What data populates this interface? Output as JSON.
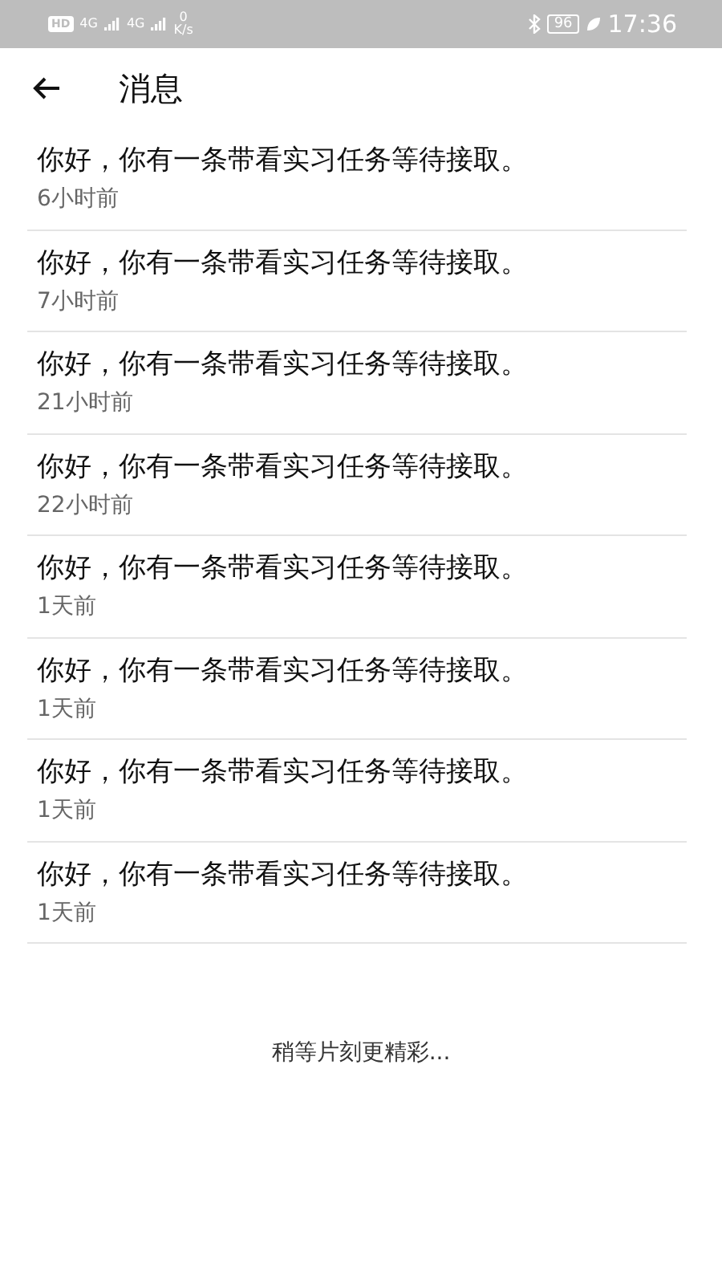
{
  "status_bar": {
    "hd": "HD",
    "networks": [
      "4G",
      "4G"
    ],
    "speed_value": "0",
    "speed_unit": "K/s",
    "battery": "96",
    "time": "17:36"
  },
  "header": {
    "title": "消息"
  },
  "messages": [
    {
      "text": "你好，你有一条带看实习任务等待接取。",
      "time": "6小时前"
    },
    {
      "text": "你好，你有一条带看实习任务等待接取。",
      "time": "7小时前"
    },
    {
      "text": "你好，你有一条带看实习任务等待接取。",
      "time": "21小时前"
    },
    {
      "text": "你好，你有一条带看实习任务等待接取。",
      "time": "22小时前"
    },
    {
      "text": "你好，你有一条带看实习任务等待接取。",
      "time": "1天前"
    },
    {
      "text": "你好，你有一条带看实习任务等待接取。",
      "time": "1天前"
    },
    {
      "text": "你好，你有一条带看实习任务等待接取。",
      "time": "1天前"
    },
    {
      "text": "你好，你有一条带看实习任务等待接取。",
      "time": "1天前"
    }
  ],
  "footer": "稍等片刻更精彩..."
}
